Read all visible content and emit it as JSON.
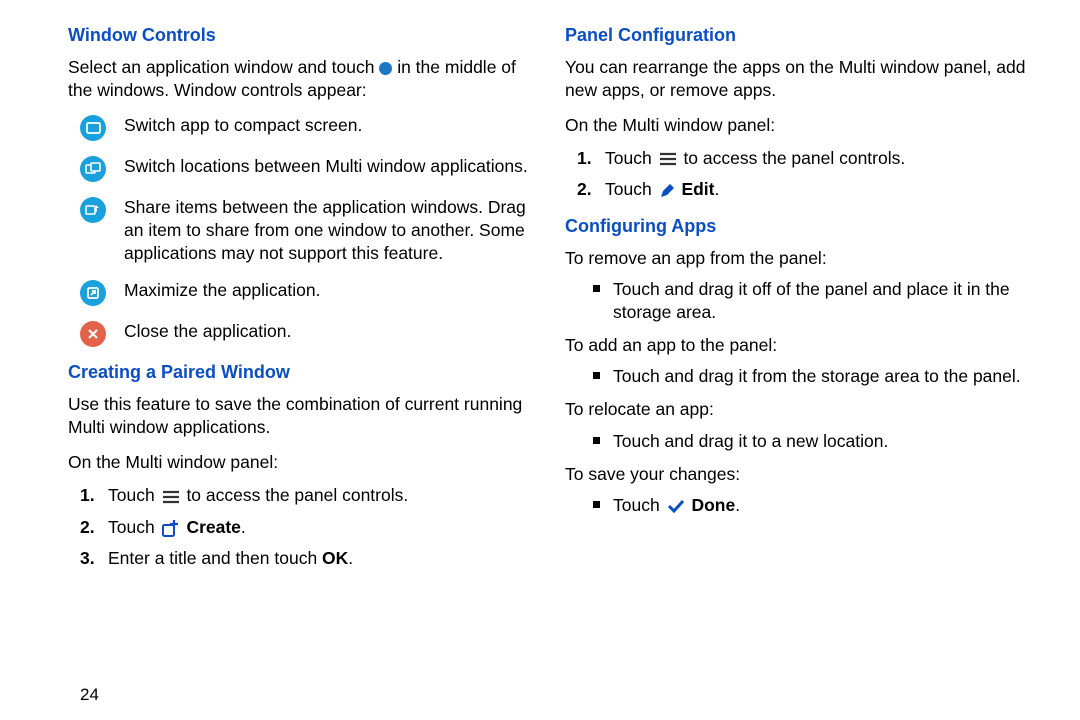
{
  "left": {
    "h1": "Window Controls",
    "intro_a": "Select an application window and touch ",
    "intro_b": " in the middle of the windows. Window controls appear:",
    "items": [
      "Switch app to compact screen.",
      "Switch locations between Multi window applications.",
      "Share items between the application windows. Drag an item to share from one window to another. Some applications may not support this feature.",
      "Maximize the application.",
      "Close the application."
    ],
    "h2": "Creating a Paired Window",
    "p2": "Use this feature to save the combination of current running Multi window applications.",
    "p3": "On the Multi window panel:",
    "ol": [
      {
        "pre": "Touch ",
        "post": " to access the panel controls."
      },
      {
        "pre": "Touch ",
        "bold": "Create",
        "post": "."
      },
      {
        "pre": "Enter a title and then touch ",
        "bold": "OK",
        "post": "."
      }
    ]
  },
  "right": {
    "h1": "Panel Configuration",
    "p1": "You can rearrange the apps on the Multi window panel, add new apps, or remove apps.",
    "p2": "On the Multi window panel:",
    "ol": [
      {
        "pre": "Touch ",
        "post": " to access the panel controls."
      },
      {
        "pre": "Touch ",
        "bold": "Edit",
        "post": "."
      }
    ],
    "h2": "Configuring Apps",
    "s1": "To remove an app from the panel:",
    "b1": "Touch and drag it off of the panel and place it in the storage area.",
    "s2": "To add an app to the panel:",
    "b2": "Touch and drag it from the storage area to the panel.",
    "s3": "To relocate an app:",
    "b3": "Touch and drag it to a new location.",
    "s4": "To save your changes:",
    "b4_pre": "Touch ",
    "b4_bold": "Done",
    "b4_post": "."
  },
  "pagenum": "24"
}
